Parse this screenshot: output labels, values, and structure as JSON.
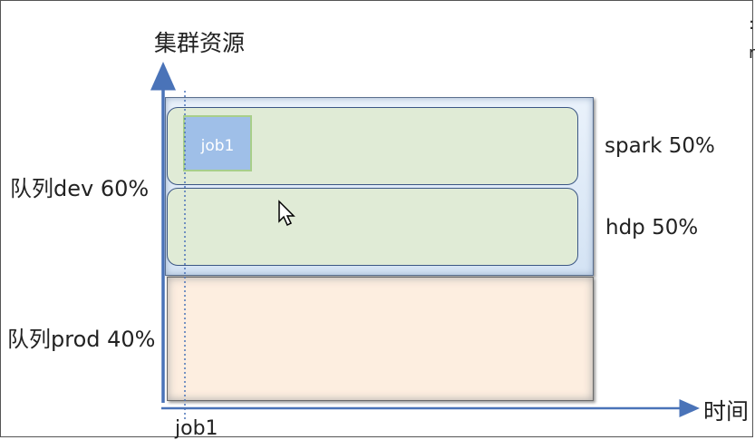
{
  "axis": {
    "y_title": "集群资源",
    "x_title": "时间"
  },
  "queues": {
    "dev": {
      "label": "队列dev 60%"
    },
    "prod": {
      "label": "队列prod 40%"
    }
  },
  "sub_queues": {
    "spark": {
      "label": "spark 50%"
    },
    "hdp": {
      "label": "hdp 50%"
    }
  },
  "job": {
    "box_label": "job1",
    "axis_label": "job1"
  },
  "colors": {
    "axis": "#4a73b8",
    "dev_queue": "#d4e3f4",
    "sub_queue": "#e0ebd6",
    "prod_queue": "#fdeee0",
    "job": "#9fbfe8"
  }
}
